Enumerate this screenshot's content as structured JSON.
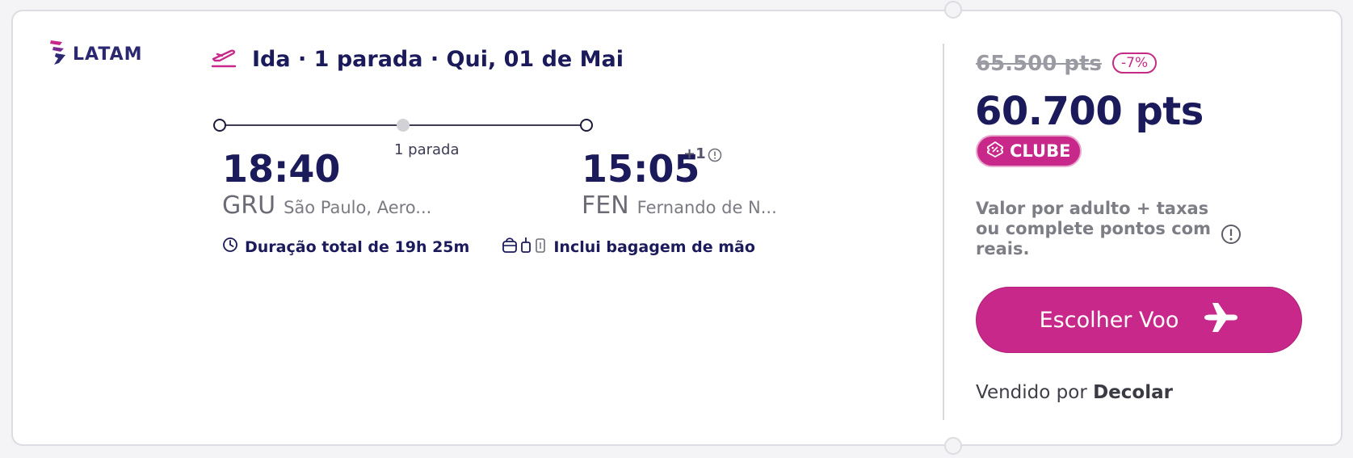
{
  "airline": {
    "name": "LATAM"
  },
  "trip": {
    "title": "Ida · 1 parada · Qui, 01 de Mai",
    "stops_label": "1 parada",
    "departure": {
      "time": "18:40",
      "iata": "GRU",
      "city": "São Paulo, Aero..."
    },
    "arrival": {
      "time": "15:05",
      "day_offset": "+1",
      "iata": "FEN",
      "city": "Fernando de N..."
    },
    "duration": "Duração total de 19h 25m",
    "baggage": "Inclui bagagem de mão"
  },
  "pricing": {
    "old_price": "65.500 pts",
    "discount": "-7%",
    "price": "60.700 pts",
    "badge": "CLUBE",
    "note": "Valor por adulto + taxas ou complete pontos com reais."
  },
  "actions": {
    "choose_label": "Escolher Voo"
  },
  "seller": {
    "prefix": "Vendido por",
    "name": "Decolar"
  },
  "colors": {
    "brand": "#c8288a",
    "navy": "#1b1a5a",
    "muted": "#7d7d86"
  },
  "icons": [
    "latam-logo-icon",
    "plane-takeoff-icon",
    "info-icon",
    "clock-icon",
    "baggage-icon",
    "clube-ticket-icon",
    "airplane-icon"
  ]
}
